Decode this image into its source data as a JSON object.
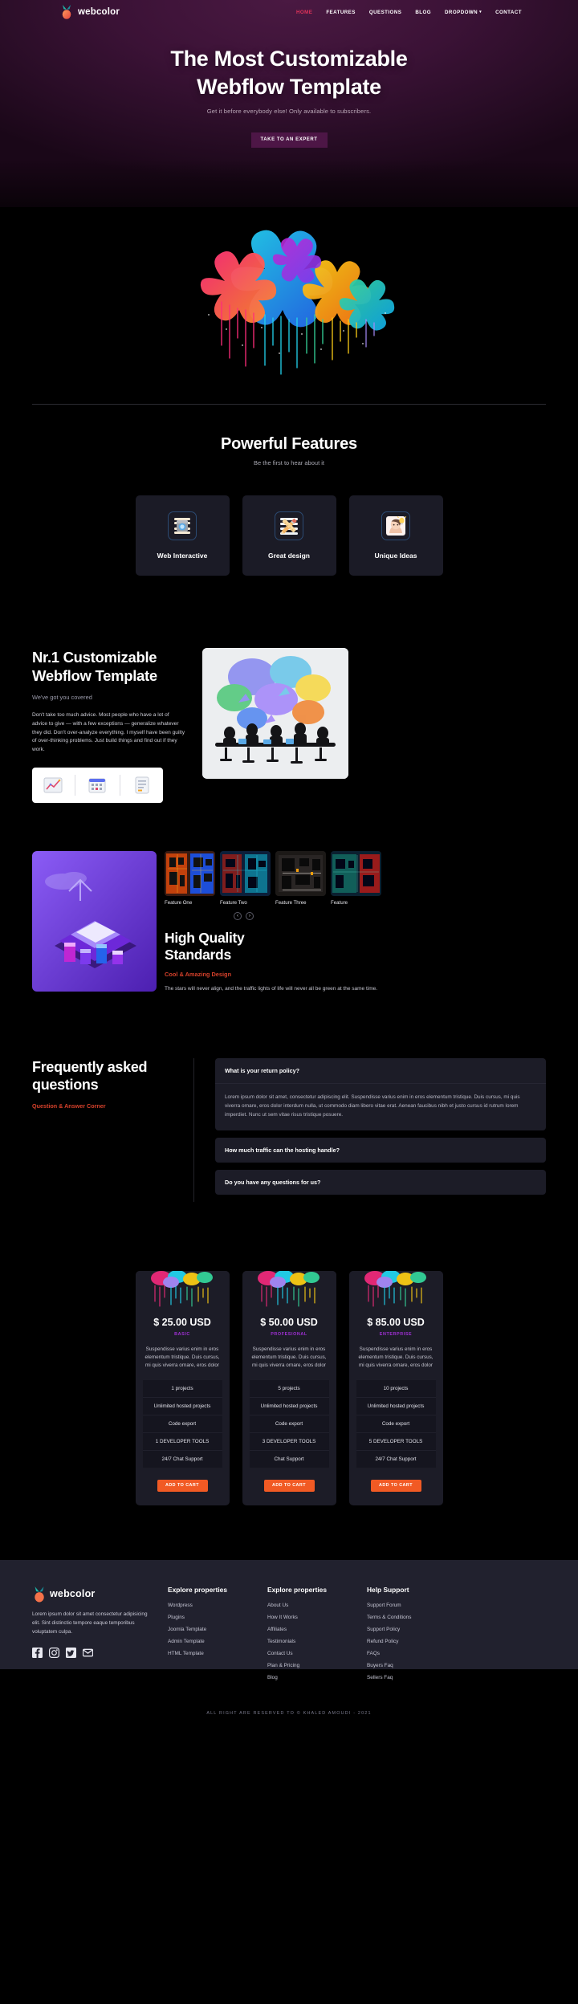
{
  "nav": {
    "brand": "webcolor",
    "brand_logo_icon": "leaf-drop-logo",
    "links": [
      {
        "label": "HOME",
        "active": true
      },
      {
        "label": "FEATURES",
        "active": false
      },
      {
        "label": "QUESTIONS",
        "active": false
      },
      {
        "label": "BLOG",
        "active": false
      },
      {
        "label": "DROPDOWN",
        "active": false,
        "caret": "▾"
      },
      {
        "label": "CONTACT",
        "active": false
      }
    ],
    "active_color": "#e0335a"
  },
  "hero": {
    "title_line1": "The Most Customizable",
    "title_line2": "Webflow Template",
    "subtitle": "Get it before everybody else! Only available to subscribers.",
    "cta": "TAKE TO AN EXPERT",
    "cta_color": "#4d1646"
  },
  "features": {
    "title": "Powerful Features",
    "subtitle": "Be the first to hear about it",
    "cards": [
      {
        "label": "Web Interactive",
        "icon": "camera-chip-icon"
      },
      {
        "label": "Great design",
        "icon": "pencil-ruler-icon"
      },
      {
        "label": "Unique Ideas",
        "icon": "lightbulb-head-icon"
      }
    ]
  },
  "nr1": {
    "title_line1": "Nr.1 Customizable",
    "title_line2": "Webflow Template",
    "kicker": "We've got you covered",
    "body": "Don't take too much advice. Most people who have a lot of advice to give — with a few exceptions — generalize whatever they did. Don't over-analyze everything. I myself have been guilty of over-thinking problems. Just build things and find out if they work.",
    "thumbs": [
      "chart-thumb-icon",
      "calendar-thumb-icon",
      "document-thumb-icon"
    ],
    "image_alt": "meeting-illustration"
  },
  "hq": {
    "title_line1": "High Quality",
    "title_line2": "Standards",
    "kicker": "Cool & Amazing Design",
    "body": "The stars will never align, and the traffic lights of life will never all be green at the same time.",
    "main_image_alt": "laptop-isometric-illustration",
    "tiles": [
      {
        "caption": "Feature One",
        "image": "circuit-board-orange"
      },
      {
        "caption": "Feature Two",
        "image": "circuit-board-blue"
      },
      {
        "caption": "Feature Three",
        "image": "chip-board-dark"
      },
      {
        "caption": "Feature",
        "image": "circuit-board-teal"
      }
    ],
    "prev": "‹",
    "next": "›"
  },
  "faq": {
    "title_line1": "Frequently asked",
    "title_line2": "questions",
    "kicker": "Question & Answer Corner",
    "items": [
      {
        "question": "What is your return policy?",
        "answer": "Lorem ipsum dolor sit amet, consectetur adipiscing elit. Suspendisse varius enim in eros elementum tristique. Duis cursus, mi quis viverra ornare, eros dolor interdum nulla, ut commodo diam libero vitae erat. Aenean faucibus nibh et justo cursus id rutrum lorem imperdiet. Nunc ut sem vitae risus tristique posuere.",
        "open": true
      },
      {
        "question": "How much traffic can the hosting handle?",
        "answer": "",
        "open": false
      },
      {
        "question": "Do you have any questions for us?",
        "answer": "",
        "open": false
      }
    ]
  },
  "pricing": {
    "plans": [
      {
        "amount": "$ 25.00 USD",
        "plan": "BASIC",
        "plan_color": "#a12fd6",
        "desc": "Suspendisse varius enim in eros elementum tristique. Duis cursus, mi quis viverra ornare, eros dolor",
        "features": [
          "1 projects",
          "Unlimited hosted projects",
          "Code export",
          "1 DEVELOPER TOOLS",
          "24/7 Chat Support"
        ],
        "cta": "ADD TO CART"
      },
      {
        "amount": "$ 50.00 USD",
        "plan": "PROFESIONAL",
        "plan_color": "#a12fd6",
        "desc": "Suspendisse varius enim in eros elementum tristique. Duis cursus, mi quis viverra ornare, eros dolor",
        "features": [
          "5 projects",
          "Unlimited hosted projects",
          "Code export",
          "3 DEVELOPER TOOLS",
          "Chat Support"
        ],
        "cta": "ADD TO CART"
      },
      {
        "amount": "$ 85.00 USD",
        "plan": "ENTERPRISE",
        "plan_color": "#a12fd6",
        "desc": "Suspendisse varius enim in eros elementum tristique. Duis cursus, mi quis viverra ornare, eros dolor",
        "features": [
          "10 projects",
          "Unlimited hosted projects",
          "Code export",
          "5 DEVELOPER TOOLS",
          "24/7 Chat Support"
        ],
        "cta": "ADD TO CART"
      }
    ],
    "cta_color": "#f15a24"
  },
  "footer": {
    "brand": "webcolor",
    "description": "Lorem ipsum dolor sit amet consectetur adipisicing elit. Sint distinctio tempore eaque temporibus voluptatem culpa.",
    "social": [
      {
        "name": "facebook-icon",
        "glyph": "f"
      },
      {
        "name": "instagram-icon",
        "glyph": "◎"
      },
      {
        "name": "twitter-icon",
        "glyph": "t"
      },
      {
        "name": "email-icon",
        "glyph": "✉"
      }
    ],
    "columns": [
      {
        "title": "Explore properties",
        "links": [
          "Wordpress",
          "Plugins",
          "Joomla Template",
          "Admin Template",
          "HTML Template"
        ]
      },
      {
        "title": "Explore properties",
        "links": [
          "About Us",
          "How It Works",
          "Affiliates",
          "Testimonials",
          "Contact Us",
          "Plan & Pricing",
          "Blog"
        ]
      },
      {
        "title": "Help Support",
        "links": [
          "Support Forum",
          "Terms & Conditions",
          "Support Policy",
          "Refund Policy",
          "FAQs",
          "Buyers Faq",
          "Sellers Faq"
        ]
      }
    ],
    "copyright": "ALL RIGHT ARE RESERVED TO © KHALED AMOUDI - 2021"
  }
}
